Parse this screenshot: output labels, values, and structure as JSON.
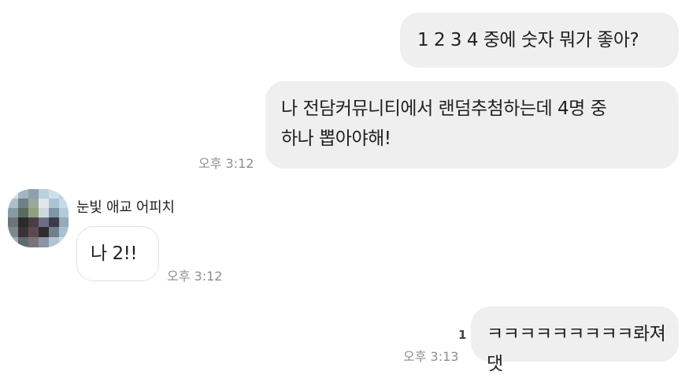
{
  "messages": [
    {
      "side": "me",
      "text": "1 2 3 4 중에 숫자 뭐가 좋아?",
      "time": ""
    },
    {
      "side": "me",
      "text_line1": "나 전담커뮤니티에서 랜덤추첨하는데 4명 중",
      "text_line2": "하나 뽑아야해!",
      "time": "오후 3:12"
    },
    {
      "side": "other",
      "sender": "눈빛 애교 어피치",
      "text": "나 2!!",
      "time": "오후 3:12"
    },
    {
      "side": "me",
      "text": "ㅋㅋㅋㅋㅋㅋㅋㅋㅋ롸져댓",
      "unread_count": "1",
      "time": "오후 3:13"
    }
  ],
  "avatar": {
    "icon": "blurred-profile-avatar",
    "colors": [
      "#b9d6e8",
      "#7f8f96",
      "#2a2a2e",
      "#8fa080",
      "#d7dde3",
      "#4b3b44",
      "#a8c0cf"
    ]
  }
}
